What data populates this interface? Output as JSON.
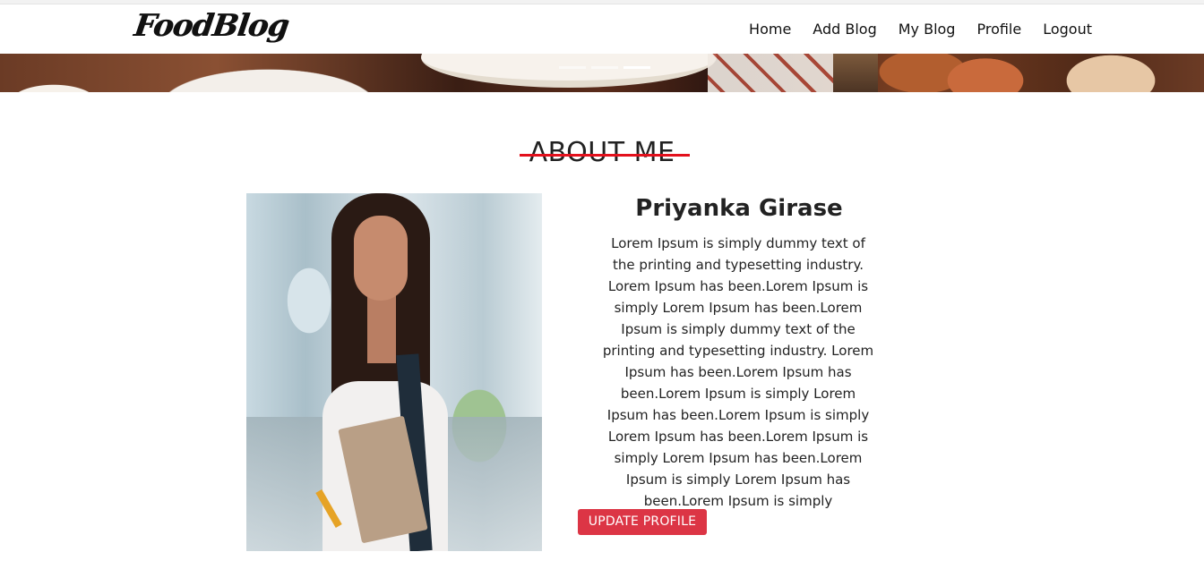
{
  "navbar": {
    "brand": "FoodBlog",
    "links": [
      {
        "label": "Home"
      },
      {
        "label": "Add Blog"
      },
      {
        "label": "My Blog"
      },
      {
        "label": "Profile"
      },
      {
        "label": "Logout"
      }
    ]
  },
  "hero": {
    "slide_count": 3,
    "active_slide": 3
  },
  "about": {
    "title": "ABOUT ME",
    "accent_color": "#e3101c",
    "name": "Priyanka Girase",
    "bio": "Lorem Ipsum is simply dummy text of the printing and typesetting industry. Lorem Ipsum has been.Lorem Ipsum is simply Lorem Ipsum has been.Lorem Ipsum is simply dummy text of the printing and typesetting industry. Lorem Ipsum has been.Lorem Ipsum has been.Lorem Ipsum is simply Lorem Ipsum has been.Lorem Ipsum is simply Lorem Ipsum has been.Lorem Ipsum is simply Lorem Ipsum has been.Lorem Ipsum is simply Lorem Ipsum has been.Lorem Ipsum is simply",
    "update_button_label": "UPDATE PROFILE",
    "update_button_color": "#dc3545"
  }
}
